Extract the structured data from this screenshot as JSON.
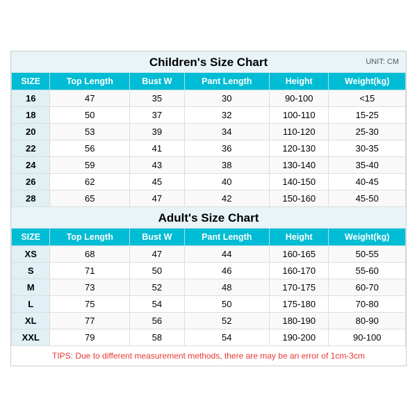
{
  "page": {
    "children_title": "Children's Size Chart",
    "adult_title": "Adult's Size Chart",
    "unit": "UNIT: CM",
    "tips": "TIPS: Due to different measurement methods, there are may be an error of 1cm-3cm",
    "headers": [
      "SIZE",
      "Top Length",
      "Bust W",
      "Pant Length",
      "Height",
      "Weight(kg)"
    ],
    "children_rows": [
      [
        "16",
        "47",
        "35",
        "30",
        "90-100",
        "<15"
      ],
      [
        "18",
        "50",
        "37",
        "32",
        "100-110",
        "15-25"
      ],
      [
        "20",
        "53",
        "39",
        "34",
        "110-120",
        "25-30"
      ],
      [
        "22",
        "56",
        "41",
        "36",
        "120-130",
        "30-35"
      ],
      [
        "24",
        "59",
        "43",
        "38",
        "130-140",
        "35-40"
      ],
      [
        "26",
        "62",
        "45",
        "40",
        "140-150",
        "40-45"
      ],
      [
        "28",
        "65",
        "47",
        "42",
        "150-160",
        "45-50"
      ]
    ],
    "adult_rows": [
      [
        "XS",
        "68",
        "47",
        "44",
        "160-165",
        "50-55"
      ],
      [
        "S",
        "71",
        "50",
        "46",
        "160-170",
        "55-60"
      ],
      [
        "M",
        "73",
        "52",
        "48",
        "170-175",
        "60-70"
      ],
      [
        "L",
        "75",
        "54",
        "50",
        "175-180",
        "70-80"
      ],
      [
        "XL",
        "77",
        "56",
        "52",
        "180-190",
        "80-90"
      ],
      [
        "XXL",
        "79",
        "58",
        "54",
        "190-200",
        "90-100"
      ]
    ]
  }
}
